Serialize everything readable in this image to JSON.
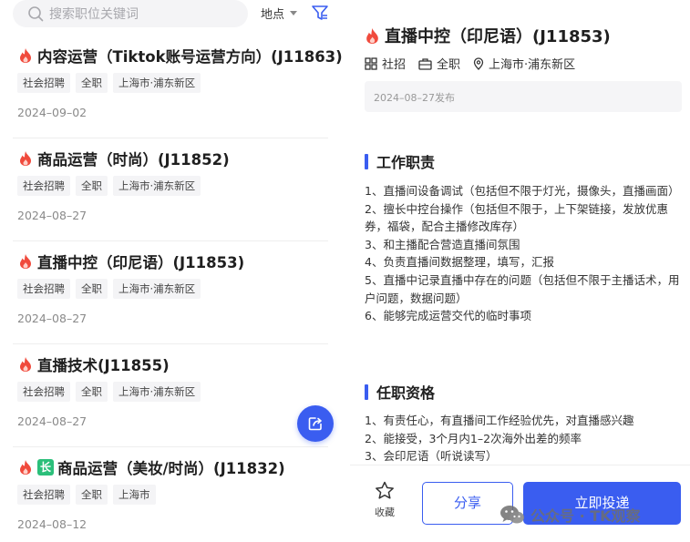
{
  "search": {
    "placeholder": "搜索职位关键词"
  },
  "filters": {
    "location_label": "地点"
  },
  "jobs": [
    {
      "title": "内容运营（Tiktok账号运营方向）(J11863)",
      "hot": true,
      "badge": "",
      "tags": [
        "社会招聘",
        "全职",
        "上海市·浦东新区"
      ],
      "date": "2024–09–02"
    },
    {
      "title": "商品运营（时尚）(J11852)",
      "hot": true,
      "badge": "",
      "tags": [
        "社会招聘",
        "全职",
        "上海市·浦东新区"
      ],
      "date": "2024–08–27"
    },
    {
      "title": "直播中控（印尼语）(J11853)",
      "hot": true,
      "badge": "",
      "tags": [
        "社会招聘",
        "全职",
        "上海市·浦东新区"
      ],
      "date": "2024–08–27"
    },
    {
      "title": "直播技术(J11855)",
      "hot": true,
      "badge": "",
      "tags": [
        "社会招聘",
        "全职",
        "上海市·浦东新区"
      ],
      "date": "2024–08–27"
    },
    {
      "title": "商品运营（美妆/时尚）(J11832)",
      "hot": true,
      "badge": "长",
      "tags": [
        "社会招聘",
        "全职",
        "上海市"
      ],
      "date": "2024–08–12"
    }
  ],
  "detail": {
    "title": "直播中控（印尼语）(J11853)",
    "meta": {
      "recruit_type": "社招",
      "job_type": "全职",
      "location": "上海市·浦东新区"
    },
    "published": "2024–08–27发布",
    "duties": {
      "heading": "工作职责",
      "items": [
        "1、直播间设备调试（包括但不限于灯光，摄像头，直播画面）",
        "2、擅长中控台操作（包括但不限于，上下架链接，发放优惠券，福袋，配合主播修改库存）",
        "3、和主播配合营造直播间氛围",
        "4、负责直播间数据整理，填写，汇报",
        "5、直播中记录直播中存在的问题（包括但不限于主播话术，用户问题，数据问题）",
        "6、能够完成运营交代的临时事项"
      ]
    },
    "requirements": {
      "heading": "任职资格",
      "items": [
        "1、有责任心，有直播间工作经验优先，对直播感兴趣",
        "2、能接受，3个月内1–2次海外出差的频率",
        "3、会印尼语（听说读写）"
      ]
    }
  },
  "actions": {
    "favorite_label": "收藏",
    "share_label": "分享",
    "apply_label": "立即投递"
  },
  "watermark": {
    "text": "公众号 · TK观察"
  },
  "colors": {
    "accent": "#3a5df0",
    "hot": "#f04a3c",
    "badge_green": "#2bbf7a"
  }
}
